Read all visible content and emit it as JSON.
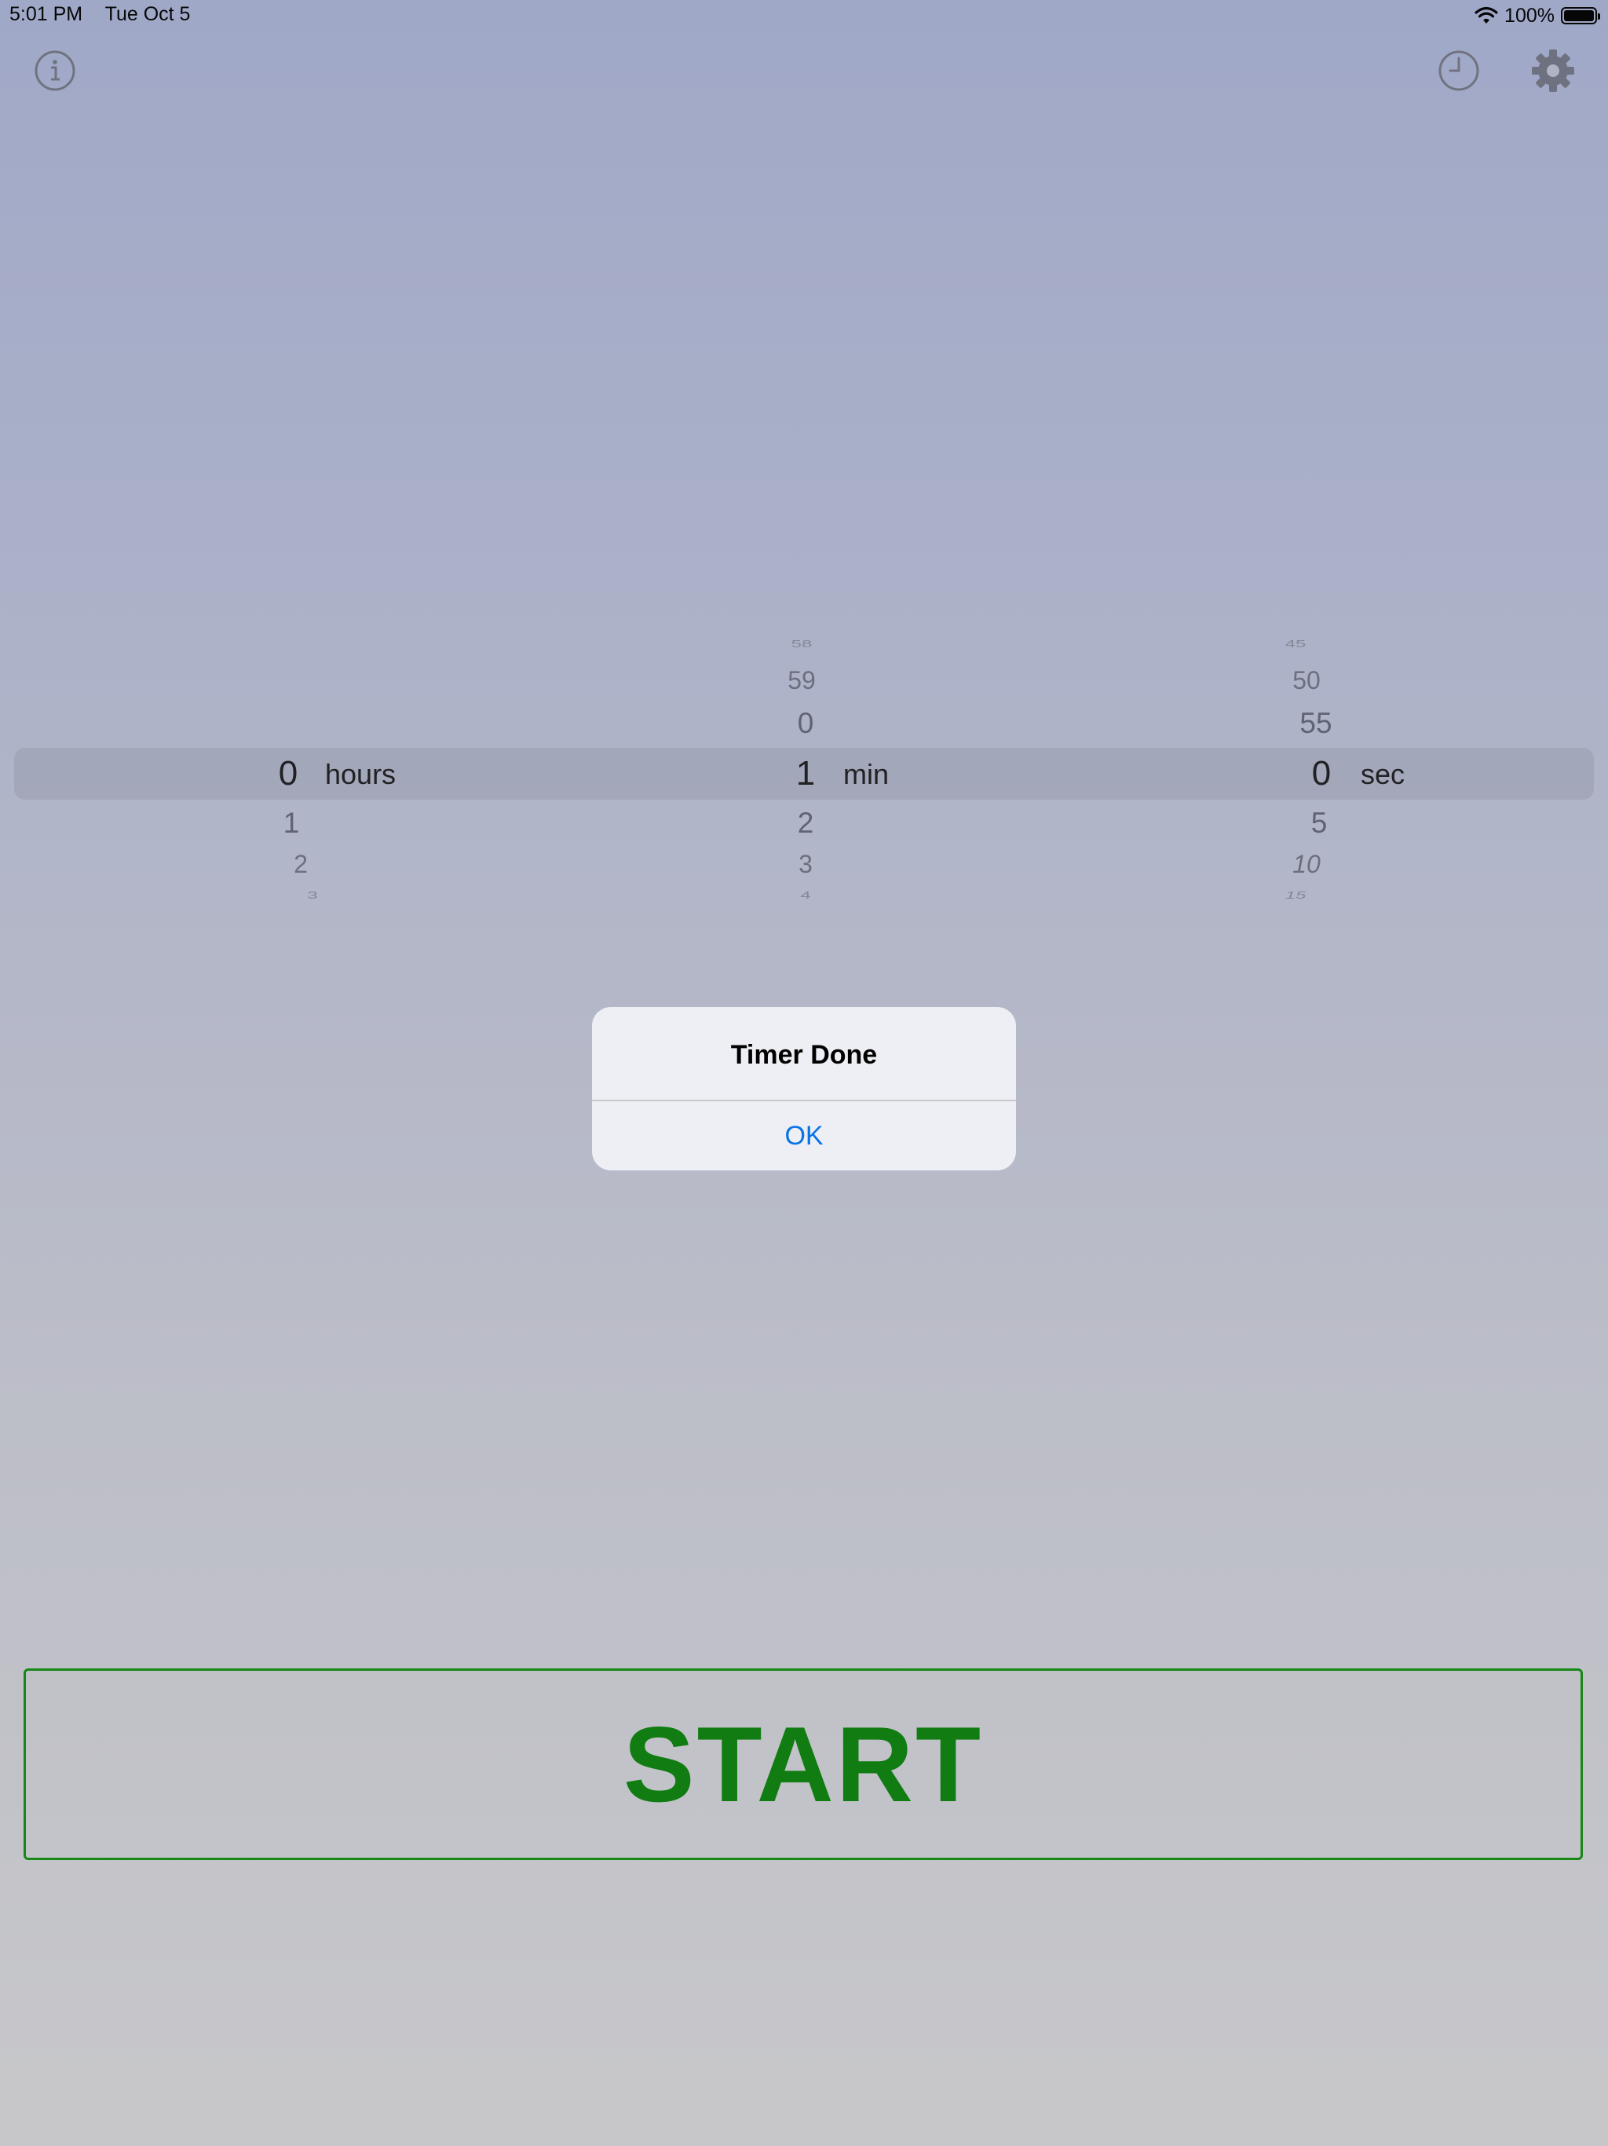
{
  "status_bar": {
    "time": "5:01 PM",
    "date": "Tue Oct 5",
    "battery_text": "100%",
    "battery_level": 1.0
  },
  "toolbar": {
    "info_icon": "info-icon",
    "history_icon": "clock-icon",
    "settings_icon": "gear-icon"
  },
  "picker": {
    "hours": {
      "above": [],
      "selected": "0",
      "below": [
        "1",
        "2",
        "3"
      ],
      "unit": "hours"
    },
    "minutes": {
      "above": [
        "58",
        "59",
        "0"
      ],
      "selected": "1",
      "below": [
        "2",
        "3",
        "4"
      ],
      "unit": "min"
    },
    "seconds": {
      "above": [
        "45",
        "50",
        "55"
      ],
      "selected": "0",
      "below": [
        "5",
        "10",
        "15"
      ],
      "unit": "sec"
    }
  },
  "alert": {
    "title": "Timer Done",
    "ok_label": "OK"
  },
  "start_button": {
    "label": "START"
  },
  "colors": {
    "start_green": "#0a7d0a",
    "alert_button_blue": "#0a73e6",
    "icon_gray": "#6e7180"
  }
}
